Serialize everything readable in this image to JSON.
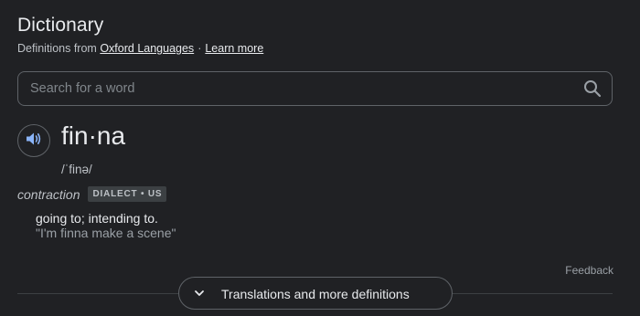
{
  "header": {
    "title": "Dictionary",
    "source_prefix": "Definitions from",
    "source_link": "Oxford Languages",
    "separator": "·",
    "learn_more": "Learn more"
  },
  "search": {
    "placeholder": "Search for a word",
    "value": "",
    "icon": "search-icon"
  },
  "entry": {
    "speaker_icon": "speaker-icon",
    "headword": "fin·na",
    "pronunciation": "/ˈfinə/",
    "part_of_speech": "contraction",
    "badge": "DIALECT • US",
    "definition": "going to; intending to.",
    "example": "\"I'm finna make a scene\""
  },
  "footer": {
    "feedback": "Feedback",
    "more_button": "Translations and more definitions",
    "more_icon": "chevron-down-icon"
  },
  "colors": {
    "background": "#202124",
    "text_primary": "#e8eaed",
    "text_secondary": "#bdc1c6",
    "border": "#5f6368",
    "accent_speaker": "#8ab4f8"
  }
}
